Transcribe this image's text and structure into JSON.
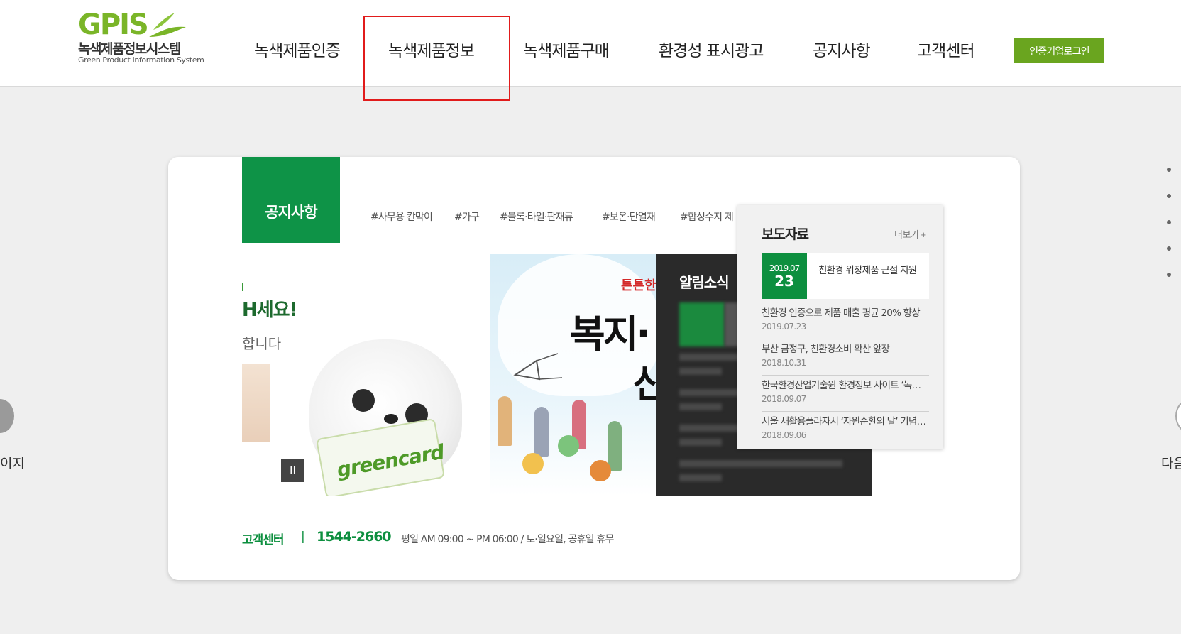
{
  "header": {
    "logo_mark": "GPIS",
    "logo_kr": "녹색제품정보시스템",
    "logo_en": "Green Product Information System",
    "nav": [
      {
        "label": "녹색제품인증"
      },
      {
        "label": "녹색제품정보"
      },
      {
        "label": "녹색제품구매"
      },
      {
        "label": "환경성 표시광고"
      },
      {
        "label": "공지사항"
      },
      {
        "label": "고객센터"
      }
    ],
    "login_label": "인증기업로그인"
  },
  "side": {
    "prev_label": "이지",
    "next_label": "다음"
  },
  "main": {
    "notice_tab": "공지사항",
    "tags": [
      "#사무용 칸막이",
      "#가구",
      "#블록·타일·판재류",
      "#보온·단열재",
      "#합성수지 제"
    ],
    "banner1": {
      "headline": "H세요!",
      "sub": "합니다",
      "card_text": "greencard",
      "pause_label": "II"
    },
    "banner2": {
      "tag": "튼튼한",
      "big1": "복지·",
      "big2": "신"
    },
    "banner3": {
      "title": "알림소식"
    },
    "press": {
      "title": "보도자료",
      "more": "더보기 +",
      "feature": {
        "date_ym": "2019.07",
        "date_d": "23",
        "title": "친환경 위장제품 근절 지원"
      },
      "items": [
        {
          "title": "친환경 인증으로 제품 매출 평균 20% 향상",
          "date": "2019.07.23"
        },
        {
          "title": "부산 금정구, 친환경소비 확산 앞장",
          "date": "2018.10.31"
        },
        {
          "title": "한국환경산업기술원 환경정보 사이트 ‘녹색제품’",
          "date": "2018.09.07"
        },
        {
          "title": "서울 새활용플라자서 ‘자원순환의 날’ 기념행사",
          "date": "2018.09.06"
        }
      ]
    },
    "customer_center": {
      "label": "고객센터",
      "sep": "|",
      "phone": "1544-2660",
      "hours": "평일 AM 09:00 ~ PM 06:00 / 토·일요일, 공휴일 휴무"
    }
  },
  "colors": {
    "brand_green": "#0e9347",
    "login_green": "#6aa51f",
    "highlight_red": "#e11b1b"
  }
}
